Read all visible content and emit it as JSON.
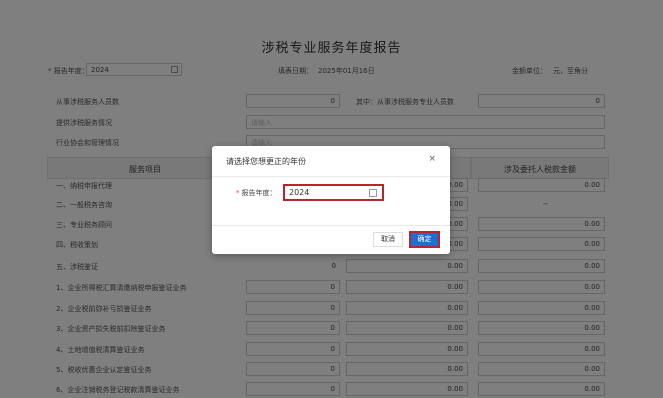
{
  "page": {
    "title": "涉税专业服务年度报告",
    "report_year_label": "* 报告年度：",
    "report_year_value": "2024",
    "fill_date_label": "填表日期：",
    "fill_date_value": "2025年01月16日",
    "unit_label": "金额单位：",
    "unit_value": "元，至角分",
    "rows": [
      {
        "label": "从事涉税服务人员数",
        "value": "0",
        "label2": "其中：从事涉税服务专业人员数",
        "value2": "0"
      },
      {
        "label": "提供涉税服务情况",
        "value": "请输入"
      },
      {
        "label": "行业协会和管理情况",
        "value": "请输入"
      }
    ],
    "table_headers": [
      "服务项目",
      "户数",
      "收入金额（元）",
      "涉及委托人税款金额"
    ],
    "table_rows": [
      {
        "label": "一、纳税申报代理",
        "v1": "0",
        "v2": "0.00",
        "v3": "0.00"
      },
      {
        "label": "二、一般税务咨询",
        "v1": "0",
        "v2": "0.00",
        "v3": "--"
      },
      {
        "label": "三、专业税务顾问",
        "v1": "0",
        "v2": "0.00",
        "v3": "0.00"
      },
      {
        "label": "四、税收策划",
        "v1": "0",
        "v2": "0.00",
        "v3": "0.00"
      },
      {
        "label": "五、涉税鉴证",
        "v1": "0",
        "v2": "0.00",
        "v3": "0.00"
      },
      {
        "label": "1、企业所得税汇算清缴纳税申报鉴证业务",
        "v1": "0",
        "v2": "0.00",
        "v3": "0.00"
      },
      {
        "label": "2、企业税前弥补亏损鉴证业务",
        "v1": "0",
        "v2": "0.00",
        "v3": "0.00"
      },
      {
        "label": "3、企业资产损失税前扣除鉴证业务",
        "v1": "0",
        "v2": "0.00",
        "v3": "0.00"
      },
      {
        "label": "4、土地增值税清算鉴证业务",
        "v1": "0",
        "v2": "0.00",
        "v3": "0.00"
      },
      {
        "label": "5、税收优惠企业认定鉴证业务",
        "v1": "0",
        "v2": "0.00",
        "v3": "0.00"
      },
      {
        "label": "6、企业注销税务登记税款清算鉴证业务",
        "v1": "0",
        "v2": "0.00",
        "v3": "0.00"
      }
    ]
  },
  "modal": {
    "title": "请选择您想更正的年份",
    "close_icon": "×",
    "field_label": "报告年度：",
    "required_mark": "*",
    "field_value": "2024",
    "cancel_label": "取消",
    "ok_label": "确定",
    "highlight_color": "#b9252c",
    "ok_color": "#1e6fd0"
  }
}
